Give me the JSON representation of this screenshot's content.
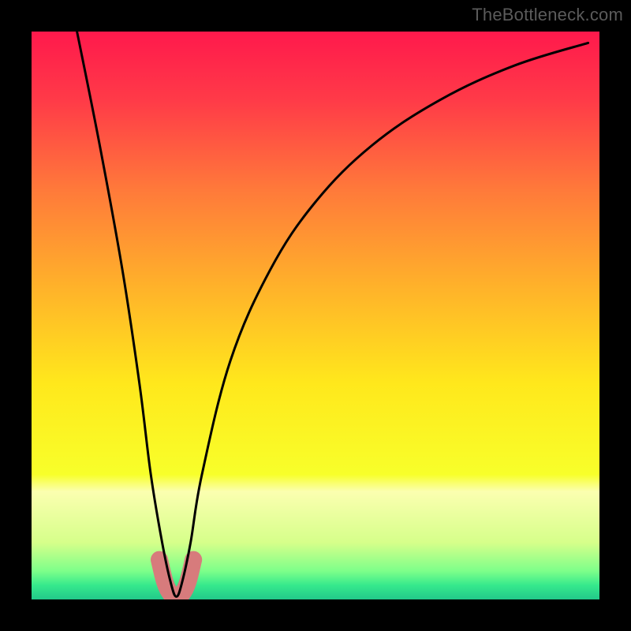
{
  "watermark": "TheBottleneck.com",
  "chart_data": {
    "type": "line",
    "title": "",
    "xlabel": "",
    "ylabel": "",
    "xlim": [
      0,
      100
    ],
    "ylim": [
      0,
      100
    ],
    "note": "Bottleneck-style V-curve over a red→yellow→green vertical gradient. No axis ticks or numeric labels are visible in the source image; x/y units unknown.",
    "series": [
      {
        "name": "main-curve",
        "color": "#000000",
        "x": [
          8,
          12,
          16,
          19,
          21,
          23,
          24.5,
          25.5,
          26.5,
          28,
          30,
          35,
          42,
          50,
          60,
          72,
          85,
          98
        ],
        "y": [
          100,
          80,
          58,
          38,
          22,
          10,
          3,
          0.5,
          3,
          10,
          22,
          42,
          58,
          70,
          80,
          88,
          94,
          98
        ]
      },
      {
        "name": "highlight-band",
        "color": "#d77b7c",
        "x": [
          22.5,
          23.5,
          24.5,
          25.5,
          26.5,
          27.5,
          28.5
        ],
        "y": [
          7,
          3,
          1,
          0.5,
          1,
          3,
          7
        ]
      }
    ],
    "background_gradient_stops": [
      {
        "pos": 0.0,
        "color": "#ff194c"
      },
      {
        "pos": 0.12,
        "color": "#ff3a48"
      },
      {
        "pos": 0.28,
        "color": "#ff7a3a"
      },
      {
        "pos": 0.45,
        "color": "#ffb22a"
      },
      {
        "pos": 0.62,
        "color": "#ffe81c"
      },
      {
        "pos": 0.78,
        "color": "#f8ff2a"
      },
      {
        "pos": 0.81,
        "color": "#fbffb0"
      },
      {
        "pos": 0.9,
        "color": "#d6ff8a"
      },
      {
        "pos": 0.95,
        "color": "#7dff8a"
      },
      {
        "pos": 0.975,
        "color": "#36e98c"
      },
      {
        "pos": 1.0,
        "color": "#22c98a"
      }
    ],
    "trough_x_fraction": 0.255
  }
}
